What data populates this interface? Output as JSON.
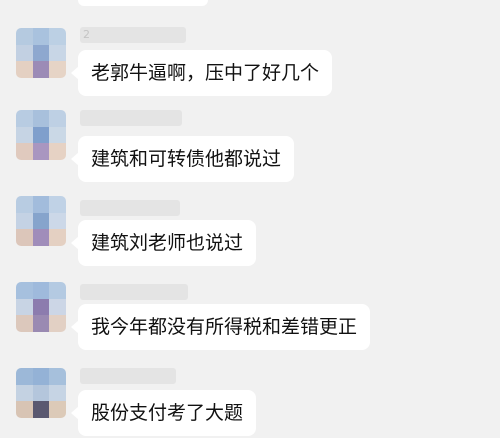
{
  "chat": {
    "messages": [
      {
        "sender": "2",
        "text": "老郭牛逼啊，压中了好几个"
      },
      {
        "sender": "",
        "text": "建筑和可转债他都说过"
      },
      {
        "sender": "",
        "text": "建筑刘老师也说过"
      },
      {
        "sender": "",
        "text": "我今年都没有所得税和差错更正"
      },
      {
        "sender": "",
        "text": "股份支付考了大题"
      }
    ]
  },
  "colors": {
    "background": "#f1f1f1",
    "bubble": "#ffffff",
    "text": "#111111",
    "avatar_blue": "#8fb0d4",
    "avatar_purple": "#9a86b8",
    "avatar_skin": "#e0c6b6"
  }
}
